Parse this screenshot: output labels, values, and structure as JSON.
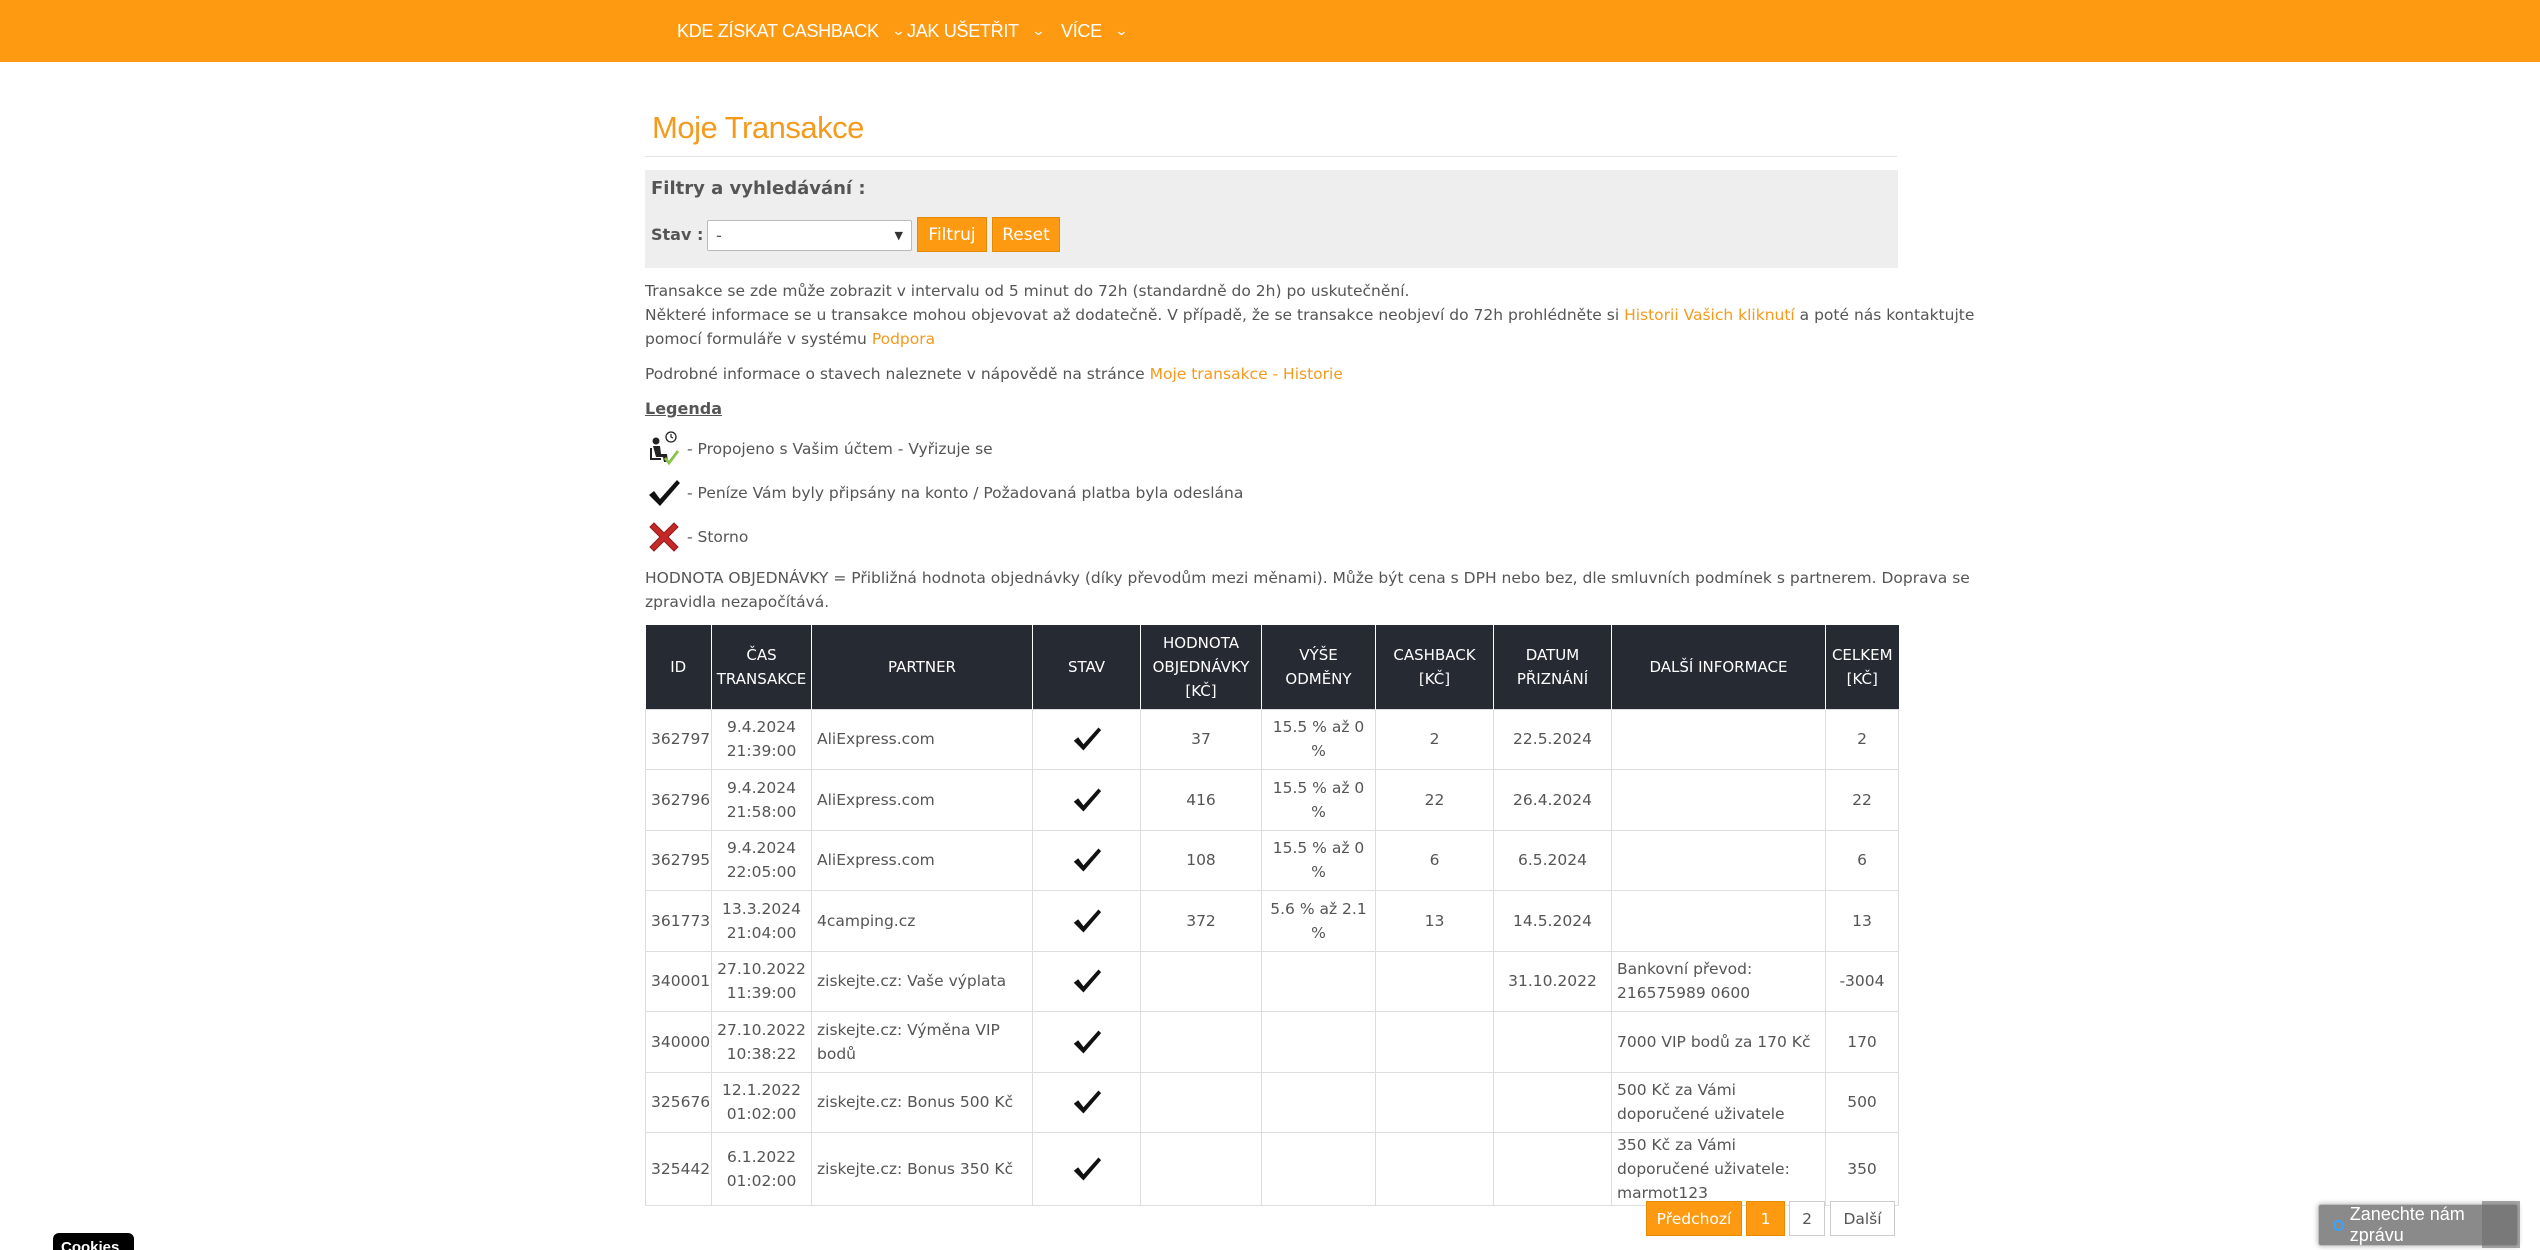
{
  "nav": {
    "items": [
      {
        "label": "Kde získat cashback"
      },
      {
        "label": "Jak ušetřit"
      },
      {
        "label": "Více"
      }
    ]
  },
  "page": {
    "title": "Moje Transakce"
  },
  "filters": {
    "heading": "Filtry a vyhledávání :",
    "stav_label": "Stav :",
    "stav_value": "-",
    "filter_button": "Filtruj",
    "reset_button": "Reset"
  },
  "info": {
    "line1": "Transakce se zde může zobrazit v intervalu od 5 minut do 72h (standardně do 2h) po uskutečnění.",
    "line2_pre": "Některé informace se u transakce mohou objevovat až dodatečně. V případě, že se transakce neobjeví do 72h prohlédněte si ",
    "line2_link": "Historii Vašich kliknutí",
    "line2_post": " a poté nás kontaktujte",
    "line3_pre": "pomocí formuláře v systému ",
    "line3_link": "Podpora",
    "line4_pre": "Podrobné informace o stavech naleznete v nápovědě na stránce ",
    "line4_link": "Moje transakce - Historie"
  },
  "legend": {
    "title": "Legenda",
    "items": [
      {
        "icon": "pending-icon",
        "text": "- Propojeno s Vašim účtem - Vyřizuje se"
      },
      {
        "icon": "checkmark-icon",
        "text": "- Peníze Vám byly připsány na konto / Požadovaná platba byla odeslána"
      },
      {
        "icon": "cross-icon",
        "text": "- Storno"
      }
    ],
    "note_line1": "HODNOTA OBJEDNÁVKY = Přibližná hodnota objednávky (díky převodům mezi měnami). Může být cena s DPH nebo bez, dle smluvních podmínek s partnerem. Doprava se",
    "note_line2": "zpravidla nezapočítává."
  },
  "table": {
    "headers": [
      "ID",
      "Čas transakce",
      "Partner",
      "Stav",
      "Hodnota objednávky [Kč]",
      "Výše odměny",
      "Cashback [Kč]",
      "Datum přiznání",
      "Další informace",
      "Celkem [Kč]"
    ],
    "rows": [
      {
        "id": "362797",
        "date": "9.4.2024",
        "time": "21:39:00",
        "partner": "AliExpress.com",
        "status_icon": "checkmark-icon",
        "order_value": "37",
        "reward": "15.5 % až 0 %",
        "cashback": "2",
        "granted": "22.5.2024",
        "info": "",
        "total": "2"
      },
      {
        "id": "362796",
        "date": "9.4.2024",
        "time": "21:58:00",
        "partner": "AliExpress.com",
        "status_icon": "checkmark-icon",
        "order_value": "416",
        "reward": "15.5 % až 0 %",
        "cashback": "22",
        "granted": "26.4.2024",
        "info": "",
        "total": "22"
      },
      {
        "id": "362795",
        "date": "9.4.2024",
        "time": "22:05:00",
        "partner": "AliExpress.com",
        "status_icon": "checkmark-icon",
        "order_value": "108",
        "reward": "15.5 % až 0 %",
        "cashback": "6",
        "granted": "6.5.2024",
        "info": "",
        "total": "6"
      },
      {
        "id": "361773",
        "date": "13.3.2024",
        "time": "21:04:00",
        "partner": "4camping.cz",
        "status_icon": "checkmark-icon",
        "order_value": "372",
        "reward": "5.6 % až 2.1 %",
        "cashback": "13",
        "granted": "14.5.2024",
        "info": "",
        "total": "13"
      },
      {
        "id": "340001",
        "date": "27.10.2022",
        "time": "11:39:00",
        "partner": "ziskejte.cz: Vaše výplata",
        "status_icon": "checkmark-icon",
        "order_value": "",
        "reward": "",
        "cashback": "",
        "granted": "31.10.2022",
        "info": "Bankovní převod: 216575989 0600",
        "total": "-3004"
      },
      {
        "id": "340000",
        "date": "27.10.2022",
        "time": "10:38:22",
        "partner": "ziskejte.cz: Výměna VIP bodů",
        "status_icon": "checkmark-icon",
        "order_value": "",
        "reward": "",
        "cashback": "",
        "granted": "",
        "info": "7000 VIP bodů za 170 Kč",
        "total": "170"
      },
      {
        "id": "325676",
        "date": "12.1.2022",
        "time": "01:02:00",
        "partner": "ziskejte.cz: Bonus 500 Kč",
        "status_icon": "checkmark-icon",
        "order_value": "",
        "reward": "",
        "cashback": "",
        "granted": "",
        "info": "500 Kč za Vámi doporučené uživatele",
        "total": "500"
      },
      {
        "id": "325442",
        "date": "6.1.2022",
        "time": "01:02:00",
        "partner": "ziskejte.cz: Bonus 350 Kč",
        "status_icon": "checkmark-icon",
        "order_value": "",
        "reward": "",
        "cashback": "",
        "granted": "",
        "info": "350 Kč za Vámi doporučené uživatele: marmot123",
        "total": "350"
      }
    ]
  },
  "pagination": {
    "prev": "Předchozí",
    "pages": [
      "1",
      "2"
    ],
    "current": "1",
    "next": "Další"
  },
  "chat": {
    "label": "Zanechte nám zprávu"
  },
  "cookies": {
    "label": "Cookies"
  },
  "colors": {
    "accent": "#fd9a12",
    "header_dark": "#262a33",
    "link": "#f49a1d"
  }
}
